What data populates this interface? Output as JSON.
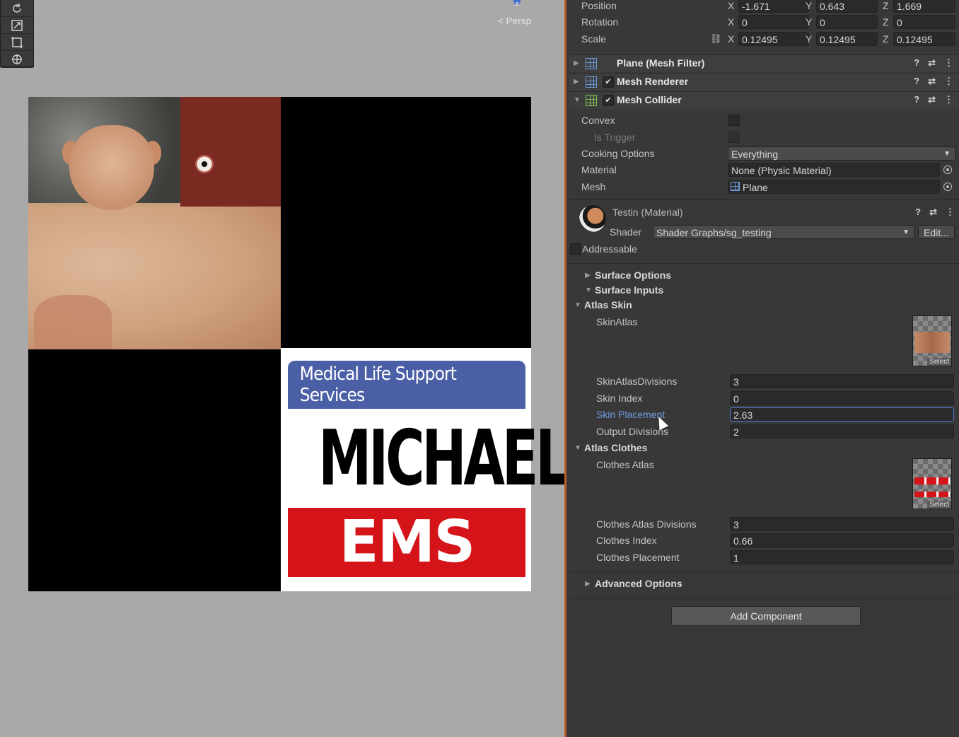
{
  "scene": {
    "gizmo_axis": "z",
    "projection_label": "< Persp",
    "toolbar_icons": [
      "rotate-icon",
      "scale-icon",
      "rect-tool-icon",
      "transform-icon"
    ],
    "texture": {
      "badge_header": "Medical Life Support Services",
      "badge_name": "MICHAEL",
      "badge_footer": "EMS"
    }
  },
  "transform": {
    "position": {
      "label": "Position",
      "x": "-1.671",
      "y": "0.643",
      "z": "1.669"
    },
    "rotation": {
      "label": "Rotation",
      "x": "0",
      "y": "0",
      "z": "0"
    },
    "scale": {
      "label": "Scale",
      "x": "0.12495",
      "y": "0.12495",
      "z": "0.12495"
    },
    "axis_x": "X",
    "axis_y": "Y",
    "axis_z": "Z"
  },
  "components": {
    "mesh_filter": "Plane (Mesh Filter)",
    "mesh_renderer": "Mesh Renderer",
    "mesh_collider": "Mesh Collider"
  },
  "collider": {
    "convex_label": "Convex",
    "is_trigger_label": "Is Trigger",
    "cooking_label": "Cooking Options",
    "cooking_value": "Everything",
    "material_label": "Material",
    "material_value": "None (Physic Material)",
    "mesh_label": "Mesh",
    "mesh_value": "Plane"
  },
  "material": {
    "name": "Testin (Material)",
    "shader_label": "Shader",
    "shader_value": "Shader Graphs/sg_testing",
    "edit_label": "Edit...",
    "addressable_label": "Addressable"
  },
  "sections": {
    "surface_options": "Surface Options",
    "surface_inputs": "Surface Inputs",
    "atlas_skin": "Atlas Skin",
    "atlas_clothes": "Atlas Clothes",
    "advanced_options": "Advanced Options"
  },
  "atlas_skin": {
    "skin_atlas_label": "SkinAtlas",
    "select_label": "Select",
    "divisions_label": "SkinAtlasDivisions",
    "divisions_value": "3",
    "skin_index_label": "Skin Index",
    "skin_index_value": "0",
    "skin_placement_label": "Skin Placement",
    "skin_placement_value": "2.63",
    "output_divisions_label": "Output Divisions",
    "output_divisions_value": "2"
  },
  "atlas_clothes": {
    "clothes_atlas_label": "Clothes Atlas",
    "select_label": "Select",
    "divisions_label": "Clothes Atlas Divisions",
    "divisions_value": "3",
    "index_label": "Clothes Index",
    "index_value": "0.66",
    "placement_label": "Clothes Placement",
    "placement_value": "1"
  },
  "add_component_label": "Add Component",
  "header_icons": {
    "help": "?",
    "preset": "⇄",
    "menu": "⋮"
  },
  "colors": {
    "scene_bg": "#a9a9a9",
    "inspector_bg": "#383838",
    "accent_border": "#c25a2e",
    "focus": "#4a7bd1"
  }
}
